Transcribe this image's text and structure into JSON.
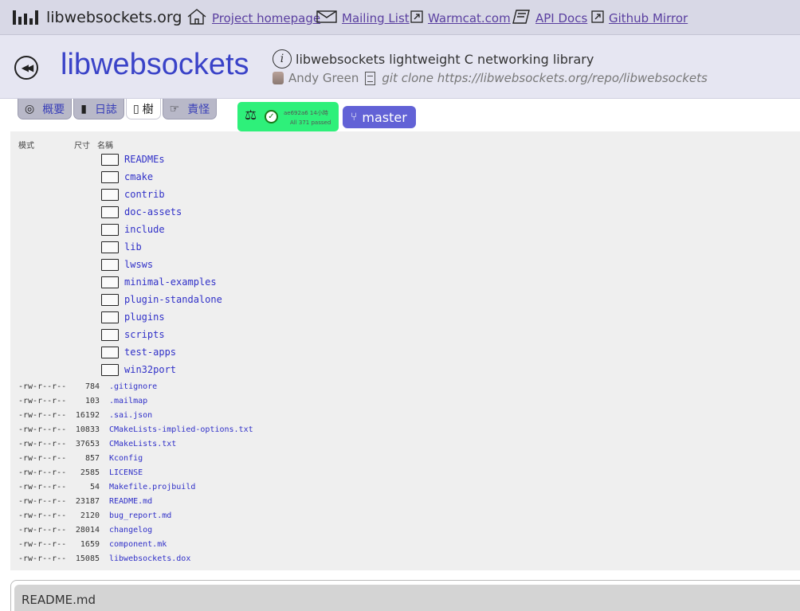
{
  "topbar": {
    "brand": "libwebsockets.org",
    "links": [
      {
        "label": "Project homepage",
        "icon": "home-icon"
      },
      {
        "label": "Mailing List",
        "icon": "envelope-icon"
      },
      {
        "label": "Warmcat.com",
        "icon": "external-link-icon"
      },
      {
        "label": "API Docs",
        "icon": "book-icon"
      },
      {
        "label": "Github Mirror",
        "icon": "external-link-icon"
      }
    ]
  },
  "repo": {
    "name": "libwebsockets",
    "description": "libwebsockets lightweight C networking library",
    "owner": "Andy Green",
    "clone": "git clone https://libwebsockets.org/repo/libwebsockets"
  },
  "tabs": [
    {
      "label": "概要",
      "icon": "summary-icon"
    },
    {
      "label": "日誌",
      "icon": "log-icon"
    },
    {
      "label": "樹",
      "icon": "tree-icon"
    },
    {
      "label": "責怪",
      "icon": "blame-icon"
    }
  ],
  "active_tab": "樹",
  "ci": {
    "line1": "ae692a6 14小時",
    "line2": "All 371 passed"
  },
  "branch": "master",
  "tree": {
    "headers": {
      "mode": "模式",
      "size": "尺寸",
      "name": "名稱"
    },
    "dirs": [
      "READMEs",
      "cmake",
      "contrib",
      "doc-assets",
      "include",
      "lib",
      "lwsws",
      "minimal-examples",
      "plugin-standalone",
      "plugins",
      "scripts",
      "test-apps",
      "win32port"
    ],
    "files": [
      {
        "mode": "-rw-r--r--",
        "size": "784",
        "name": ".gitignore"
      },
      {
        "mode": "-rw-r--r--",
        "size": "103",
        "name": ".mailmap"
      },
      {
        "mode": "-rw-r--r--",
        "size": "16192",
        "name": ".sai.json"
      },
      {
        "mode": "-rw-r--r--",
        "size": "10833",
        "name": "CMakeLists-implied-options.txt"
      },
      {
        "mode": "-rw-r--r--",
        "size": "37653",
        "name": "CMakeLists.txt"
      },
      {
        "mode": "-rw-r--r--",
        "size": "857",
        "name": "Kconfig"
      },
      {
        "mode": "-rw-r--r--",
        "size": "2585",
        "name": "LICENSE"
      },
      {
        "mode": "-rw-r--r--",
        "size": "54",
        "name": "Makefile.projbuild"
      },
      {
        "mode": "-rw-r--r--",
        "size": "23187",
        "name": "README.md"
      },
      {
        "mode": "-rw-r--r--",
        "size": "2120",
        "name": "bug_report.md"
      },
      {
        "mode": "-rw-r--r--",
        "size": "28014",
        "name": "changelog"
      },
      {
        "mode": "-rw-r--r--",
        "size": "1659",
        "name": "component.mk"
      },
      {
        "mode": "-rw-r--r--",
        "size": "15085",
        "name": "libwebsockets.dox"
      }
    ]
  },
  "readme": {
    "title": "README.md"
  }
}
